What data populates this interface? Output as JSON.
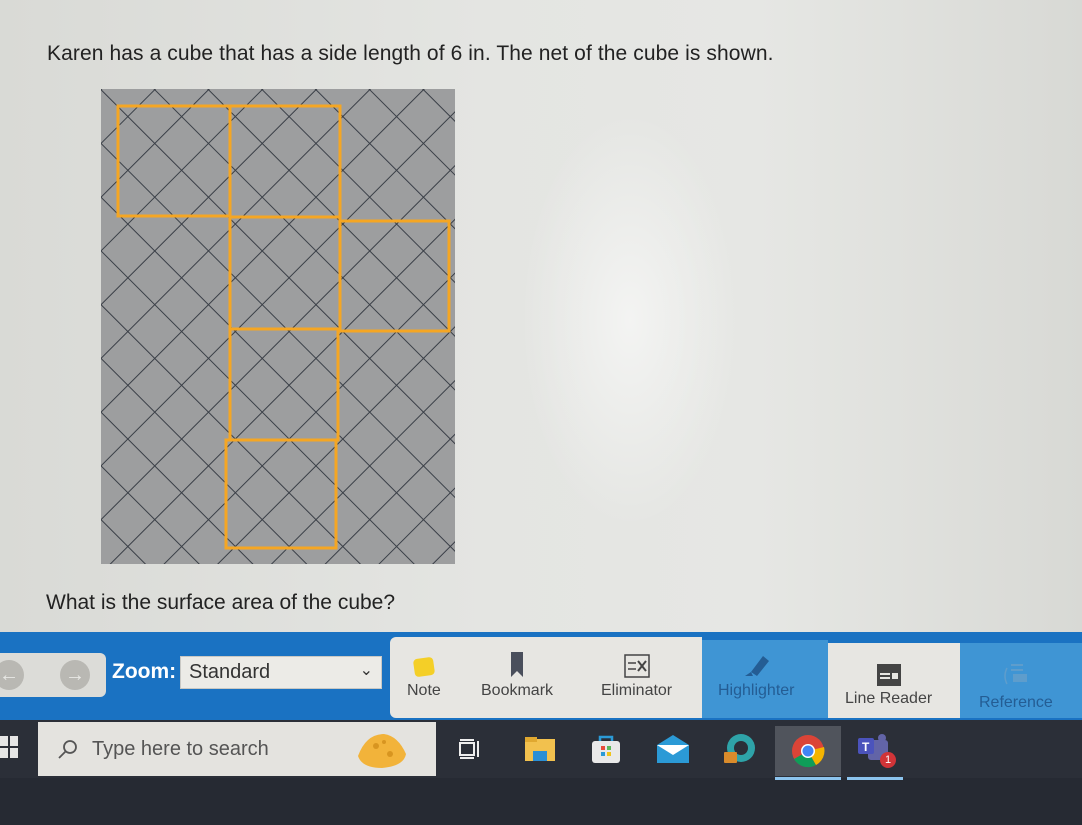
{
  "question": {
    "text": "Karen has a cube that has a side length of 6 in. The net of the cube is shown.",
    "prompt": "What is the surface area of the cube?",
    "figure": {
      "description": "net of a cube on diagonal grid",
      "outline_color": "#f5a623",
      "grid_color": "#3a3f47",
      "background_color": "#9d9e9f",
      "faces": 6
    }
  },
  "toolbar": {
    "back_icon": "arrow-left-icon",
    "forward_icon": "arrow-right-icon",
    "zoom_label": "Zoom:",
    "zoom_value": "Standard",
    "tools": [
      {
        "label": "Note",
        "icon": "note-icon"
      },
      {
        "label": "Bookmark",
        "icon": "bookmark-icon"
      },
      {
        "label": "Eliminator",
        "icon": "eliminator-icon"
      },
      {
        "label": "Highlighter",
        "icon": "highlighter-icon"
      },
      {
        "label": "Line Reader",
        "icon": "line-reader-icon"
      },
      {
        "label": "Reference",
        "icon": "reference-icon"
      }
    ],
    "colors": {
      "bar": "#1a72c2",
      "active_tool": "#3f95d4"
    }
  },
  "taskbar": {
    "search_placeholder": "Type here to search",
    "apps": [
      {
        "name": "task-view",
        "icon": "task-view-icon"
      },
      {
        "name": "file-explorer",
        "icon": "folder-icon"
      },
      {
        "name": "microsoft-store",
        "icon": "store-icon"
      },
      {
        "name": "mail",
        "icon": "mail-icon"
      },
      {
        "name": "edge",
        "icon": "edge-icon"
      },
      {
        "name": "chrome",
        "icon": "chrome-icon"
      },
      {
        "name": "teams",
        "icon": "teams-icon",
        "badge": "1"
      }
    ]
  }
}
